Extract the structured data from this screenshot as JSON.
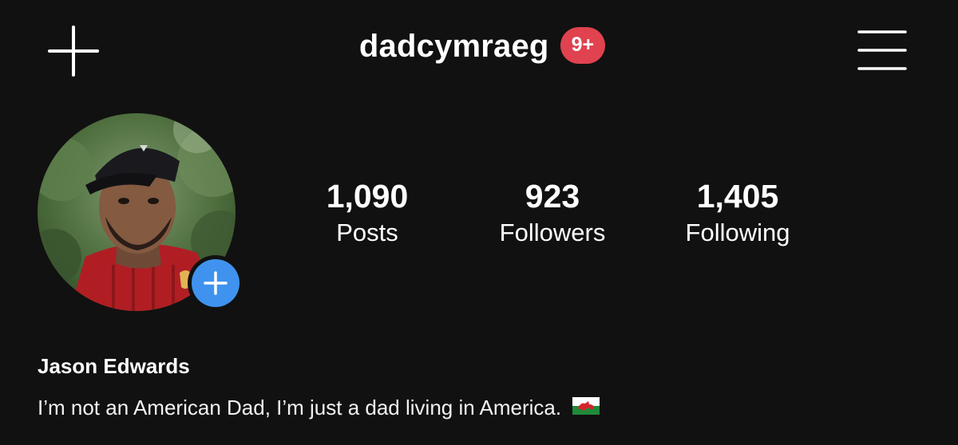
{
  "header": {
    "username": "dadcymraeg",
    "notification_badge": "9+",
    "add_icon": "plus-icon",
    "menu_icon": "hamburger-menu-icon"
  },
  "profile": {
    "avatar_alt": "profile-photo",
    "story_add_icon": "plus-icon"
  },
  "stats": [
    {
      "value": "1,090",
      "label": "Posts"
    },
    {
      "value": "923",
      "label": "Followers"
    },
    {
      "value": "1,405",
      "label": "Following"
    }
  ],
  "bio": {
    "name": "Jason Edwards",
    "text": "I’m not an American Dad, I’m just a dad living in America.",
    "emoji": "welsh-flag-icon"
  },
  "colors": {
    "background": "#111111",
    "badge": "#e0424f",
    "story_add": "#3f93ee",
    "text": "#ffffff"
  }
}
